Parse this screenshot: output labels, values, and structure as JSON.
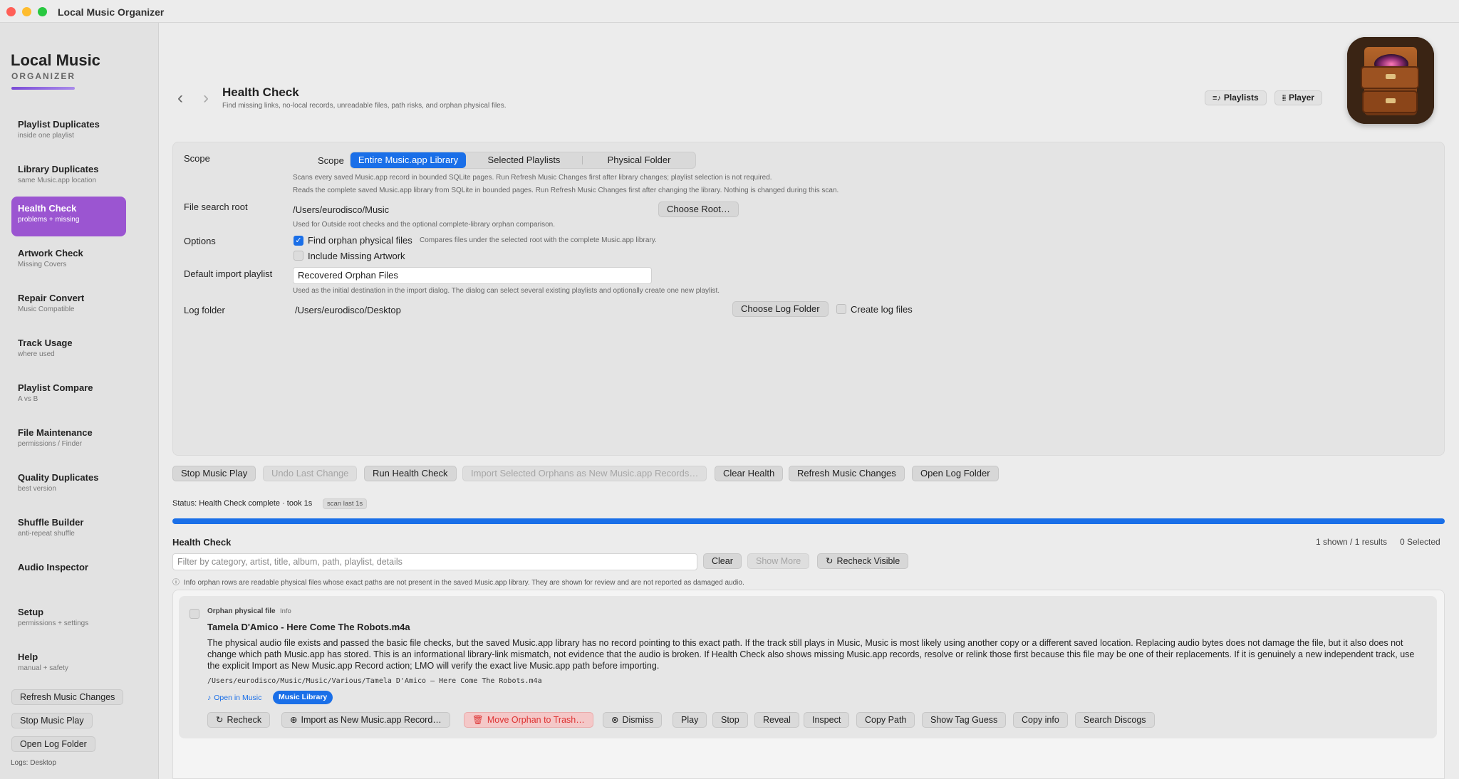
{
  "window": {
    "title": "Local Music Organizer"
  },
  "brand": {
    "title": "Local Music",
    "subtitle": "ORGANIZER"
  },
  "sidebar": {
    "items": [
      {
        "title": "Playlist Duplicates",
        "sub": "inside one playlist"
      },
      {
        "title": "Library Duplicates",
        "sub": "same Music.app location"
      },
      {
        "title": "Health Check",
        "sub": "problems + missing"
      },
      {
        "title": "Artwork Check",
        "sub": "Missing Covers"
      },
      {
        "title": "Repair Convert",
        "sub": "Music Compatible"
      },
      {
        "title": "Track Usage",
        "sub": "where used"
      },
      {
        "title": "Playlist Compare",
        "sub": "A vs B"
      },
      {
        "title": "File Maintenance",
        "sub": "permissions / Finder"
      },
      {
        "title": "Quality Duplicates",
        "sub": "best version"
      },
      {
        "title": "Shuffle Builder",
        "sub": "anti-repeat shuffle"
      },
      {
        "title": "Audio Inspector",
        "sub": ""
      },
      {
        "title": "Setup",
        "sub": "permissions + settings"
      },
      {
        "title": "Help",
        "sub": "manual + safety"
      }
    ],
    "buttons": {
      "refresh": "Refresh Music Changes",
      "stop": "Stop Music Play",
      "open_log": "Open Log Folder"
    },
    "logs_note": "Logs: Desktop"
  },
  "header": {
    "back": "‹",
    "forward": "›",
    "title": "Health Check",
    "subtitle": "Find missing links, no-local records, unreadable files, path risks, and orphan physical files.",
    "playlists_btn": "Playlists",
    "player_btn": "Player"
  },
  "settings": {
    "scope_label": "Scope",
    "scope_inline": "Scope",
    "scope_options": [
      "Entire Music.app Library",
      "Selected Playlists",
      "Physical Folder"
    ],
    "scope_note1": "Scans every saved Music.app record in bounded SQLite pages. Run Refresh Music Changes first after library changes; playlist selection is not required.",
    "scope_note2": "Reads the complete saved Music.app library from SQLite in bounded pages. Run Refresh Music Changes first after changing the library. Nothing is changed during this scan.",
    "root_label": "File search root",
    "root_value": "/Users/eurodisco/Music",
    "choose_root": "Choose Root…",
    "root_note": "Used for Outside root checks and the optional complete-library orphan comparison.",
    "options_label": "Options",
    "opt_orphan": "Find orphan physical files",
    "opt_orphan_note": "Compares files under the selected root with the complete Music.app library.",
    "opt_artwork": "Include Missing Artwork",
    "default_playlist_label": "Default import playlist",
    "default_playlist_value": "Recovered Orphan Files",
    "default_playlist_note": "Used as the initial destination in the import dialog. The dialog can select several existing playlists and optionally create one new playlist.",
    "log_label": "Log folder",
    "log_value": "/Users/eurodisco/Desktop",
    "choose_log": "Choose Log Folder",
    "create_logs": "Create log files"
  },
  "actions": {
    "stop_play": "Stop Music Play",
    "undo": "Undo Last Change",
    "run": "Run Health Check",
    "import": "Import Selected Orphans as New Music.app Records…",
    "clear_health": "Clear Health",
    "refresh": "Refresh Music Changes",
    "open_log": "Open Log Folder"
  },
  "status": {
    "text": "Status: Health Check complete · took 1s",
    "badge": "scan last 1s",
    "progress": 1.0
  },
  "results": {
    "title": "Health Check",
    "shown": "1 shown / 1 results",
    "selected": "0 Selected",
    "filter_placeholder": "Filter by category, artist, title, album, path, playlist, details",
    "clear": "Clear",
    "show_more": "Show More",
    "recheck_visible": "Recheck Visible",
    "info_note": "Info orphan rows are readable physical files whose exact paths are not present in the saved Music.app library. They are shown for review and are not reported as damaged audio."
  },
  "card": {
    "category": "Orphan physical file",
    "tag": "Info",
    "title": "Tamela D'Amico - Here Come The Robots.m4a",
    "description": "The physical audio file exists and passed the basic file checks, but the saved Music.app library has no record pointing to this exact path. If the track still plays in Music, Music is most likely using another copy or a different saved location. Replacing audio bytes does not damage the file, but it also does not change which path Music.app has stored. This is an informational library-link mismatch, not evidence that the audio is broken. If Health Check also shows missing Music.app records, resolve or relink those first because this file may be one of their replacements. If it is genuinely a new independent track, use the explicit Import as New Music.app Record action; LMO will verify the exact live Music.app path before importing.",
    "path": "/Users/eurodisco/Music/Music/Various/Tamela D'Amico — Here Come The Robots.m4a",
    "open_in_music": "Open in Music",
    "pill": "Music Library",
    "buttons": {
      "recheck": "Recheck",
      "import": "Import as New Music.app Record…",
      "trash": "Move Orphan to Trash…",
      "dismiss": "Dismiss",
      "play": "Play",
      "stop": "Stop",
      "reveal": "Reveal",
      "inspect": "Inspect",
      "copy_path": "Copy Path",
      "show_tag": "Show Tag Guess",
      "copy_info": "Copy info",
      "discogs": "Search Discogs"
    }
  },
  "colors": {
    "accent": "#1a6fe8",
    "sidebar_active": "#9b55d1",
    "danger": "#dd3333"
  }
}
